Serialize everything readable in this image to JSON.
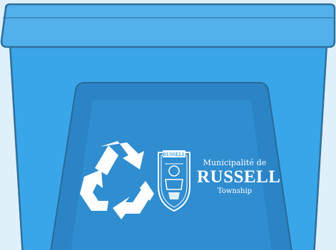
{
  "colors": {
    "background": "#dff0fa",
    "bin_body": "#3aa6ea",
    "bin_lid": "#52b0ec",
    "bin_panel": "#2a84c6",
    "outline": "#2f6f9a",
    "logo": "#ffffff"
  },
  "icons": {
    "recycle": "recycle-icon",
    "crest": "township-crest-icon"
  },
  "logo": {
    "line1": "Municipalité de",
    "line2": "RUSSELL",
    "line3": "Township",
    "crest_banner": "RUSSELL"
  }
}
